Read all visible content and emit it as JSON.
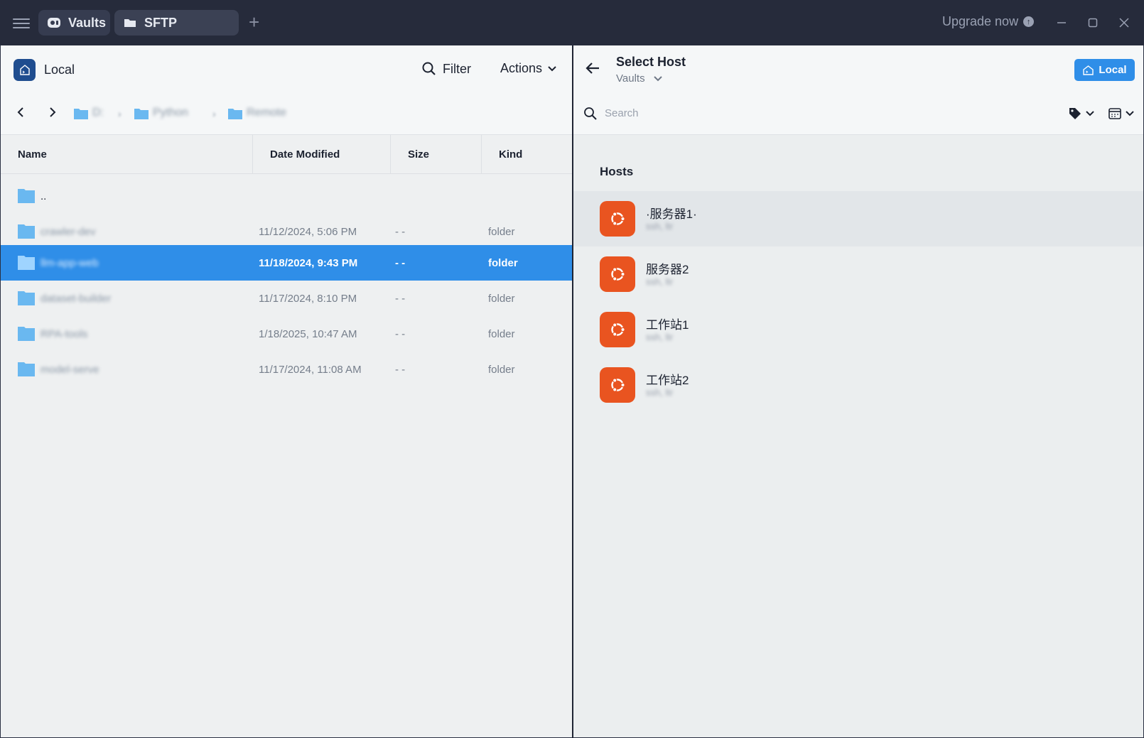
{
  "titlebar": {
    "tabs": [
      {
        "label": "Vaults",
        "icon": "vault-icon"
      },
      {
        "label": "SFTP",
        "icon": "folder-icon"
      }
    ],
    "add_tab": "+",
    "upgrade_label": "Upgrade now",
    "upgrade_icon": "arrow-up-circle-icon"
  },
  "left_panel": {
    "title": "Local",
    "filter_label": "Filter",
    "actions_label": "Actions",
    "breadcrumb": [
      "D:",
      "Python",
      "Remote"
    ],
    "columns": [
      "Name",
      "Date Modified",
      "Size",
      "Kind"
    ],
    "rows": [
      {
        "name": "..",
        "date": "",
        "size": "",
        "kind": ""
      },
      {
        "name": "crawler-dev",
        "date": "11/12/2024, 5:06 PM",
        "size": "- -",
        "kind": "folder"
      },
      {
        "name": "llm-app-web",
        "date": "11/18/2024, 9:43 PM",
        "size": "- -",
        "kind": "folder"
      },
      {
        "name": "dataset-builder",
        "date": "11/17/2024, 8:10 PM",
        "size": "- -",
        "kind": "folder"
      },
      {
        "name": "RPA-tools",
        "date": "1/18/2025, 10:47 AM",
        "size": "- -",
        "kind": "folder"
      },
      {
        "name": "model-serve",
        "date": "11/17/2024, 11:08 AM",
        "size": "- -",
        "kind": "folder"
      }
    ]
  },
  "right_panel": {
    "title": "Select Host",
    "vault_label": "Vaults",
    "local_button": "Local",
    "search_placeholder": "Search",
    "hosts_heading": "Hosts",
    "hosts": [
      {
        "name": "·服务器1·",
        "sub": "ssh, ltr"
      },
      {
        "name": "服务器2",
        "sub": "ssh, ltr"
      },
      {
        "name": "工作站1",
        "sub": "ssh, ltr"
      },
      {
        "name": "工作站2",
        "sub": "ssh, ltr"
      }
    ]
  },
  "colors": {
    "titlebar_bg": "#262b3b",
    "selection_blue": "#2f8ee8",
    "ubuntu_orange": "#e95420",
    "folder_blue": "#6ab8f0"
  }
}
